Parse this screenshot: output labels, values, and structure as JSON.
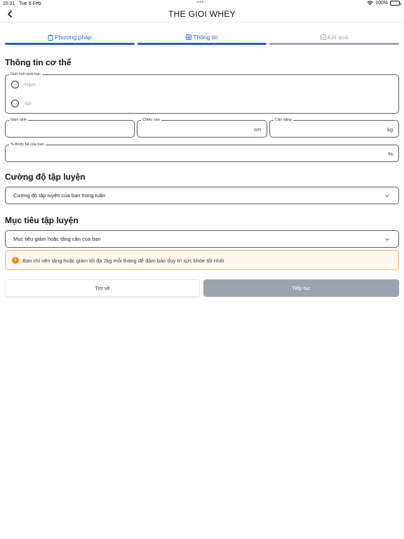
{
  "status_bar": {
    "time": "15:31",
    "date": "Tue 6 Feb",
    "battery": "100%"
  },
  "nav": {
    "title": "THE GIOI WHEY"
  },
  "steps": [
    {
      "label": "Phương pháp",
      "icon": "clipboard-icon",
      "state": "active"
    },
    {
      "label": "Thông tin",
      "icon": "list-icon",
      "state": "active"
    },
    {
      "label": "Kết quả",
      "icon": "check-square-icon",
      "state": "inactive"
    }
  ],
  "body_info": {
    "title": "Thông tin cơ thể",
    "gender": {
      "label": "Giới tính sinh học",
      "options": [
        "Nam",
        "Nữ"
      ]
    },
    "birth_year": {
      "label": "Năm sinh",
      "value": ""
    },
    "height": {
      "label": "Chiều cao",
      "unit": "cm",
      "value": ""
    },
    "weight": {
      "label": "Cân nặng",
      "unit": "kg",
      "value": ""
    },
    "body_fat": {
      "label": "% Body fat của bạn",
      "unit": "%",
      "value": ""
    }
  },
  "intensity": {
    "title": "Cường độ tập luyện",
    "placeholder": "Cường độ tập luyện của bạn trong tuần"
  },
  "goal": {
    "title": "Mục tiêu tập luyện",
    "placeholder": "Mục tiêu giảm hoặc tăng cân của bạn"
  },
  "alert": {
    "text": "Bạn chỉ nên tăng hoặc giảm tối đa 2kg mỗi tháng để đảm bảo duy trì sức khỏe tốt nhất"
  },
  "actions": {
    "back_label": "Trở về",
    "next_label": "Tiếp tục"
  },
  "colors": {
    "primary": "#2563c9",
    "inactive": "#a3a8b0",
    "warning": "#f08a24",
    "disabled_button": "#9ca3af"
  }
}
